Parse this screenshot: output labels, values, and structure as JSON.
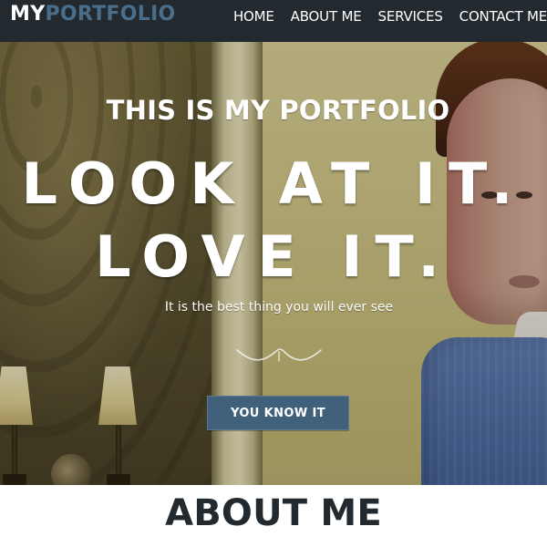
{
  "nav": {
    "logo": {
      "part1": "MY",
      "part2": "PORTFOLIO"
    },
    "links": [
      "HOME",
      "ABOUT ME",
      "SERVICES",
      "CONTACT ME"
    ],
    "colors": {
      "background": "#22292f",
      "text": "#ffffff",
      "logo_accent": "#4a6e89"
    }
  },
  "hero": {
    "kicker": "THIS IS MY PORTFOLIO",
    "title_line_1": "LOOK AT IT.",
    "title_line_2": "LOVE IT.",
    "subtitle": "It is the best thing you will ever see",
    "cta_label": "YOU KNOW IT",
    "colors": {
      "cta_bg": "#41607b",
      "text": "#ffffff"
    }
  },
  "about": {
    "heading": "ABOUT ME",
    "colors": {
      "heading": "#22292f",
      "background": "#ffffff"
    }
  }
}
